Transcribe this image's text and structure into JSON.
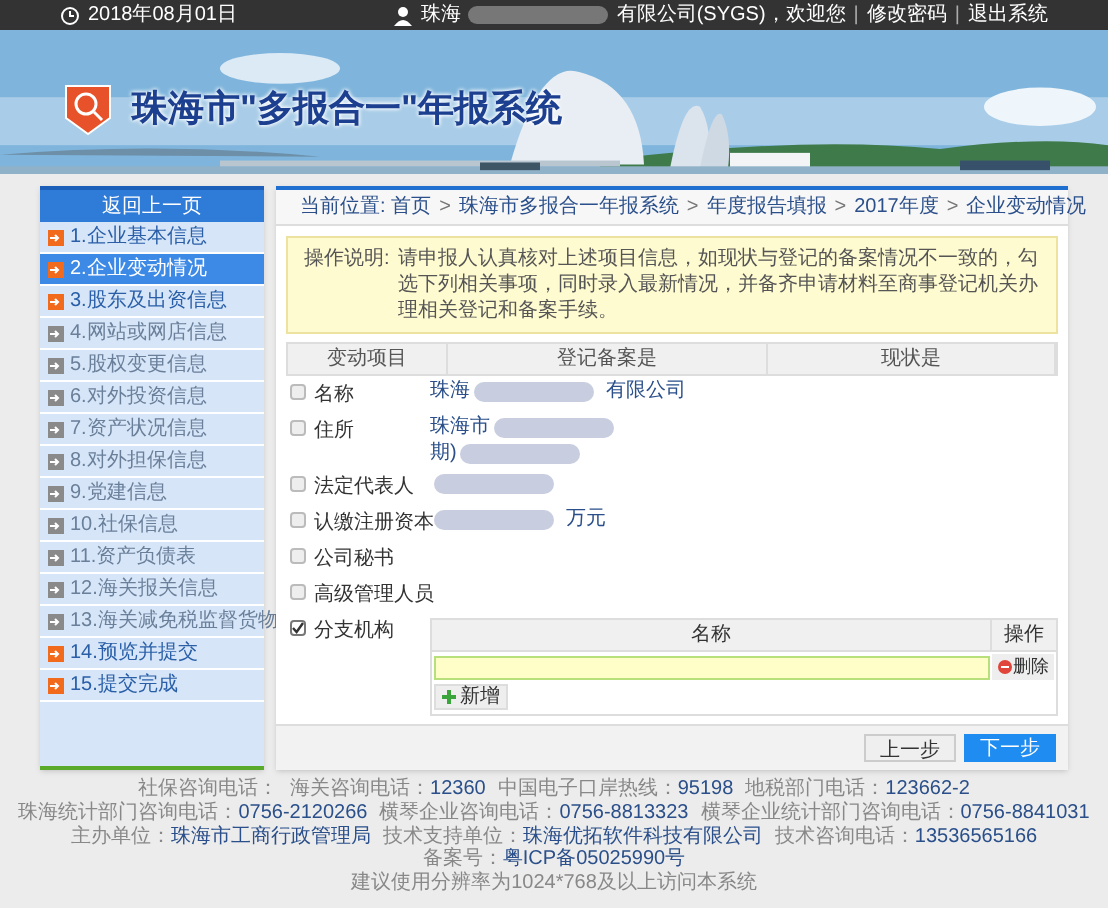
{
  "top_bar": {
    "date": "2018年08月01日",
    "user_prefix": "珠海",
    "user_suffix": "有限公司(SYGS)，欢迎您",
    "links": [
      "修改密码",
      "退出系统"
    ],
    "separator": "|"
  },
  "banner": {
    "kind": "picture",
    "title": "珠海市\"多报合一\"年报系统"
  },
  "sidebar": {
    "back": "返回上一页",
    "items": [
      {
        "label": "1.企业基本信息",
        "selected": false,
        "enabled": true
      },
      {
        "label": "2.企业变动情况",
        "selected": true,
        "enabled": true
      },
      {
        "label": "3.股东及出资信息",
        "selected": false,
        "enabled": true
      },
      {
        "label": "4.网站或网店信息",
        "selected": false,
        "enabled": false
      },
      {
        "label": "5.股权变更信息",
        "selected": false,
        "enabled": false
      },
      {
        "label": "6.对外投资信息",
        "selected": false,
        "enabled": false
      },
      {
        "label": "7.资产状况信息",
        "selected": false,
        "enabled": false
      },
      {
        "label": "8.对外担保信息",
        "selected": false,
        "enabled": false
      },
      {
        "label": "9.党建信息",
        "selected": false,
        "enabled": false
      },
      {
        "label": "10.社保信息",
        "selected": false,
        "enabled": false
      },
      {
        "label": "11.资产负债表",
        "selected": false,
        "enabled": false
      },
      {
        "label": "12.海关报关信息",
        "selected": false,
        "enabled": false
      },
      {
        "label": "13.海关减免税监督货物",
        "selected": false,
        "enabled": false
      },
      {
        "label": "14.预览并提交",
        "selected": false,
        "enabled": true
      },
      {
        "label": "15.提交完成",
        "selected": false,
        "enabled": true
      }
    ]
  },
  "breadcrumb_separator": ">",
  "breadcrumb": [
    "当前位置: 首页",
    "珠海市多报合一年报系统",
    "年度报告填报",
    "2017年度",
    "企业变动情况"
  ],
  "notice": {
    "label": "操作说明:",
    "text": "请申报人认真核对上述项目信息，如现状与登记的备案情况不一致的，勾选下列相关事项，同时录入最新情况，并备齐申请材料至商事登记机关办理相关登记和备案手续。"
  },
  "table": {
    "columns": [
      "变动项目",
      "登记备案是",
      "现状是"
    ],
    "rows": [
      {
        "item": "名称",
        "checked": false,
        "lines": [
          {
            "before": "珠海",
            "blurred": true,
            "after": "有限公司"
          }
        ]
      },
      {
        "item": "住所",
        "checked": false,
        "lines": [
          {
            "before": "珠海市",
            "blurred": true
          },
          {
            "before": "期)",
            "blurred": true
          }
        ]
      },
      {
        "item": "法定代表人",
        "checked": false,
        "lines": [
          {
            "blurred": true
          }
        ]
      },
      {
        "item": "认缴注册资本",
        "checked": false,
        "lines": [
          {
            "blurred": true,
            "after": "万元"
          }
        ]
      },
      {
        "item": "公司秘书",
        "checked": false,
        "lines": []
      },
      {
        "item": "高级管理人员",
        "checked": false,
        "lines": []
      },
      {
        "item": "分支机构",
        "checked": true,
        "lines": []
      }
    ]
  },
  "branch_table": {
    "columns": [
      "名称",
      "操作"
    ],
    "delete": "删除",
    "add": "新增"
  },
  "buttons": {
    "prev": "上一步",
    "next": "下一步"
  },
  "footer": {
    "lines": [
      [
        {
          "label": "社保咨询电话："
        },
        {
          "label": "海关咨询电话：",
          "value": "12360"
        },
        {
          "label": "中国电子口岸热线：",
          "value": "95198"
        },
        {
          "label": "地税部门电话：",
          "value": "123662-2"
        }
      ],
      [
        {
          "label": "珠海统计部门咨询电话：",
          "value": "0756-2120266"
        },
        {
          "label": "横琴企业咨询电话：",
          "value": "0756-8813323"
        },
        {
          "label": "横琴企业统计部门咨询电话：",
          "value": "0756-8841031"
        }
      ],
      [
        {
          "label": "主办单位：",
          "value": "珠海市工商行政管理局"
        },
        {
          "label": "技术支持单位：",
          "value": "珠海优拓软件科技有限公司"
        },
        {
          "label": "技术咨询电话：",
          "value": "13536565166"
        },
        {
          "label": "备案号：",
          "value": "粤ICP备05025990号"
        }
      ]
    ],
    "note": "建议使用分辨率为1024*768及以上访问本系统"
  }
}
